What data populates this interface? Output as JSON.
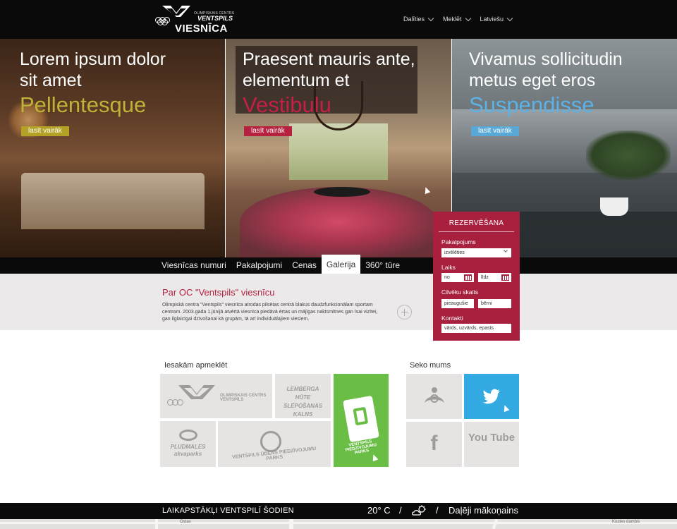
{
  "header": {
    "logo": {
      "small": "OLIMPISKAIS CENTRS",
      "mid": "VENTSPILS",
      "big": "VIESNĪCA"
    },
    "nav": [
      {
        "label": "Dalīties"
      },
      {
        "label": "Meklēt"
      },
      {
        "label": "Latviešu"
      }
    ]
  },
  "hero": [
    {
      "title": "Lorem ipsum dolor sit amet",
      "accent": "Pellentesque",
      "button": "lasīt vairāk",
      "accent_color": "#bfb238"
    },
    {
      "title": "Praesent mauris ante, elementum et",
      "accent": "Vestibulu",
      "button": "lasīt vairāk",
      "accent_color": "#c41f45"
    },
    {
      "title": "Vivamus sollicitudin metus eget eros",
      "accent": "Suspendisse",
      "button": "lasīt vairāk",
      "accent_color": "#5bb2e6"
    }
  ],
  "tabs": [
    {
      "label": "Viesnīcas numuri"
    },
    {
      "label": "Pakalpojumi"
    },
    {
      "label": "Cenas"
    },
    {
      "label": "Galerija",
      "active": true
    },
    {
      "label": "360° tūre"
    }
  ],
  "about": {
    "title": "Par OC \"Ventspils\" viesnīcu",
    "text": "Olimpiskā centra \"Ventspils\" viesnīca atrodas pilsētas centrā blakus daudzfunkcionālam sportam centram. 2003.gada 1.jūnijā atvērtā viesnīca piedāvā ērtas un mājīgas naktsmītnes gan īsai vizītei, gan ilglaicīgai dzīvošanai kā grupām, tā arī individuālajiem viesiem."
  },
  "reservation": {
    "title": "REZERVĒŠANA",
    "service_label": "Pakalpojums",
    "service_value": "izvēlēties",
    "time_label": "Laiks",
    "from_placeholder": "no",
    "to_placeholder": "līdz",
    "people_label": "Cilvēku skaits",
    "adults_placeholder": "pieaugušie",
    "children_placeholder": "bērni",
    "contacts_label": "Kontakti",
    "contacts_placeholder": "vārds, uzvārds, epasts"
  },
  "recommend": {
    "title": "Iesakām apmeklēt",
    "tiles": [
      {
        "name": "OLIMPISKAIS CENTRS VENTSPILS",
        "icon": "oc-ventspils-logo"
      },
      {
        "name": "LEMBERGA HŪTE SLĒPOŠANAS KALNS",
        "icon": "lemberga-hute-logo"
      },
      {
        "name": "VENTSPILS PIEDZĪVOJUMU PARKS",
        "icon": "adventure-park-logo"
      },
      {
        "name": "PLUDMALES akvaparks",
        "icon": "aquapark-logo"
      },
      {
        "name": "VENTSPILS ŪDENS PIEDZĪVOJUMU PARKS",
        "icon": "water-park-logo"
      }
    ]
  },
  "follow": {
    "title": "Seko mums",
    "tiles": [
      {
        "name": "draugiem",
        "icon": "draugiem-icon"
      },
      {
        "name": "twitter",
        "icon": "twitter-icon",
        "color": "#33aae1"
      },
      {
        "name": "f",
        "icon": "facebook-icon"
      },
      {
        "name": "You Tube",
        "icon": "youtube-icon"
      }
    ]
  },
  "weather": {
    "label": "LAIKAPSTĀKĻI VENTSPILĪ ŠODIEN",
    "temperature": "20° C",
    "separator": "/",
    "icon": "partly-cloudy-icon",
    "description": "Daļēji mākoņains"
  },
  "map": {
    "labels": [
      "Ostas",
      "Kustes dambis"
    ]
  }
}
